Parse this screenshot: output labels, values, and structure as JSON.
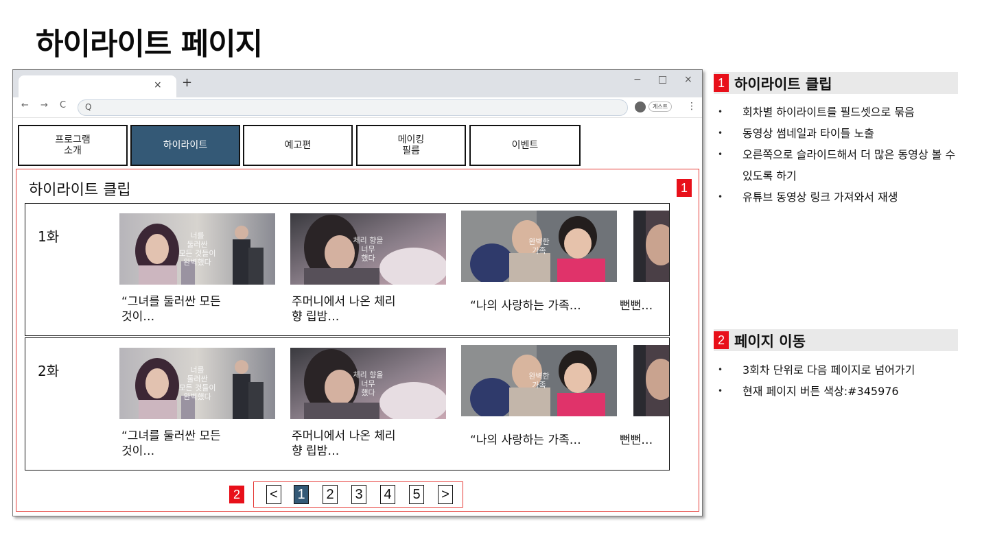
{
  "page_title": "하이라이트 페이지",
  "browser": {
    "tab_close": "×",
    "new_tab": "+",
    "minimize": "−",
    "maximize": "□",
    "close": "×",
    "back": "←",
    "forward": "→",
    "reload": "C",
    "search_glyph": "Q",
    "profile_label": "게스트",
    "more": "⋮"
  },
  "menu": [
    {
      "label": "프로그램\n소개",
      "active": false
    },
    {
      "label": "하이라이트",
      "active": true
    },
    {
      "label": "예고편",
      "active": false
    },
    {
      "label": "메이킹\n필름",
      "active": false
    },
    {
      "label": "이벤트",
      "active": false
    }
  ],
  "section": {
    "title": "하이라이트 클립",
    "badge": "1"
  },
  "episodes": [
    {
      "label": "1화",
      "clips": [
        {
          "title": "“그녀를 둘러싼 모든\n것이…",
          "overlay": "너를\n둘러싼\n모든 것들이\n완벽했다"
        },
        {
          "title": "주머니에서 나온 체리\n향 립밤…",
          "overlay": "체리 향을\n너무\n했다"
        },
        {
          "title": "“나의 사랑하는 가족…",
          "overlay": "완벽한\n가족"
        },
        {
          "title": "뻔뻔…",
          "overlay": ""
        }
      ]
    },
    {
      "label": "2화",
      "clips": [
        {
          "title": "“그녀를 둘러싼 모든\n것이…",
          "overlay": "너를\n둘러싼\n모든 것들이\n완벽했다"
        },
        {
          "title": "주머니에서 나온 체리\n향 립밤…",
          "overlay": "체리 향을\n너무\n했다"
        },
        {
          "title": "“나의 사랑하는 가족…",
          "overlay": "완벽한\n가족"
        },
        {
          "title": "뻔뻔…",
          "overlay": ""
        }
      ]
    }
  ],
  "pagination": {
    "badge": "2",
    "prev": "<",
    "next": ">",
    "pages": [
      "1",
      "2",
      "3",
      "4",
      "5"
    ],
    "current": "1"
  },
  "spec": [
    {
      "num": "1",
      "heading": "하이라이트 클립",
      "items": [
        "회차별 하이라이트를 필드셋으로 묶음",
        "동영상 썸네일과 타이틀 노출",
        "오른쪽으로 슬라이드해서 더 많은 동영상 볼 수 있도록 하기",
        "유튜브 동영상 링크 가져와서 재생"
      ]
    },
    {
      "num": "2",
      "heading": "페이지 이동",
      "items": [
        "3회차 단위로 다음 페이지로 넘어가기",
        "현재 페이지 버튼 색상:#345976"
      ]
    }
  ],
  "colors": {
    "accent": "#345976",
    "marker": "#e8101a",
    "frame": "#e53935"
  }
}
